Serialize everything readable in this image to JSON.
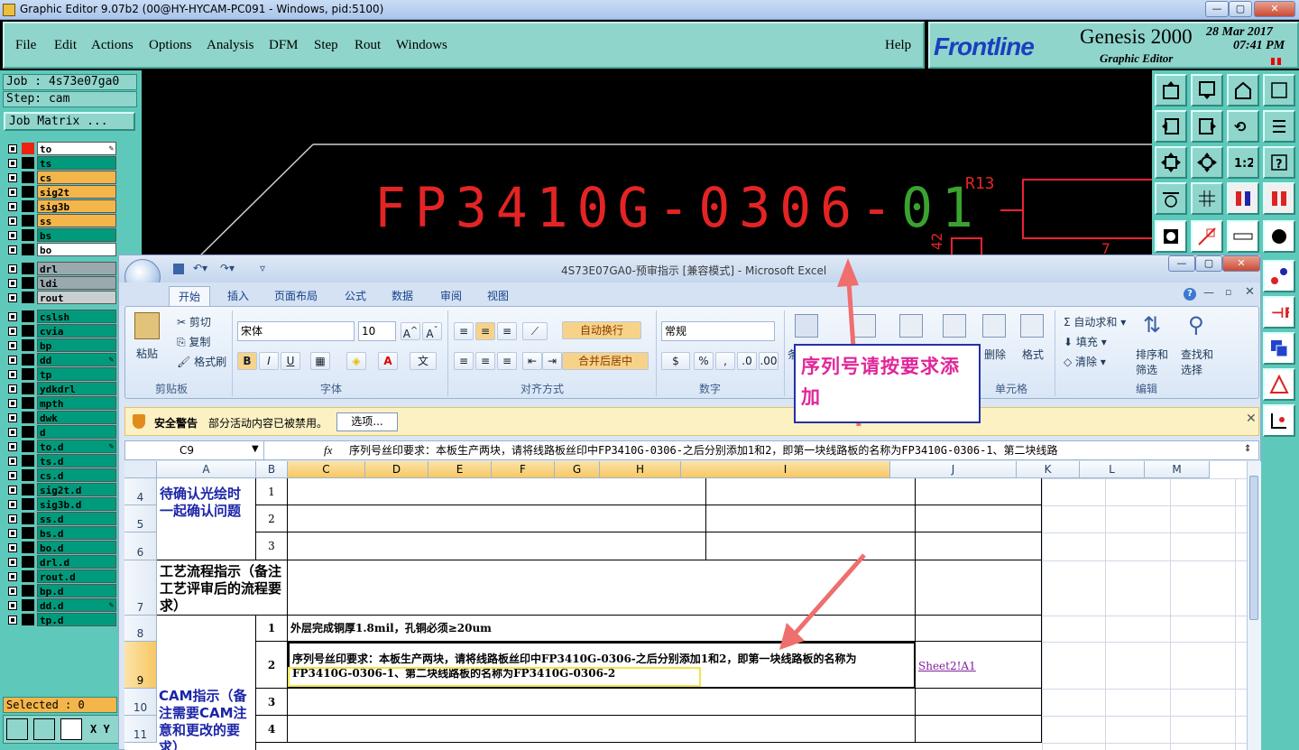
{
  "app": {
    "title": "Graphic Editor 9.07b2 (00@HY-HYCAM-PC091 - Windows, pid:5100)",
    "menu": [
      "File",
      "Edit",
      "Actions",
      "Options",
      "Analysis",
      "DFM",
      "Step",
      "Rout",
      "Windows"
    ],
    "help": "Help",
    "brand": {
      "logo": "Frontline",
      "product": "Genesis 2000",
      "subtitle": "Graphic Editor",
      "date": "28 Mar 2017",
      "time": "07:41 PM"
    }
  },
  "job_panel": {
    "job": "Job : 4s73e07ga0",
    "step": "Step: cam",
    "matrix_button": "Job Matrix ...",
    "selected": "Selected : 0",
    "xy": "X Y :",
    "layers_group1": [
      {
        "name": "to",
        "color": "#ffffff",
        "edit": true
      },
      {
        "name": "ts",
        "color": "#009b7c"
      },
      {
        "name": "cs",
        "color": "#f4b54a"
      },
      {
        "name": "sig2t",
        "color": "#f4b54a"
      },
      {
        "name": "sig3b",
        "color": "#f4b54a"
      },
      {
        "name": "ss",
        "color": "#f4b54a"
      },
      {
        "name": "bs",
        "color": "#009b7c"
      },
      {
        "name": "bo",
        "color": "#ffffff"
      }
    ],
    "layers_group2": [
      {
        "name": "drl",
        "color": "#9aa9ad"
      },
      {
        "name": "ldi",
        "color": "#9aa9ad"
      },
      {
        "name": "rout",
        "color": "#c9cfd1"
      }
    ],
    "layers_group3": [
      "cslsh",
      "cvia",
      "bp",
      "dd",
      "tp",
      "ydkdrl",
      "mpth",
      "dwk",
      "d",
      "to.d",
      "ts.d",
      "cs.d",
      "sig2t.d",
      "sig3b.d",
      "ss.d",
      "bs.d",
      "bo.d",
      "drl.d",
      "rout.d",
      "bp.d",
      "dd.d",
      "tp.d"
    ],
    "layers_group3_color": "#009b7c"
  },
  "canvas": {
    "main_text_red": "FP3410G-0306-",
    "main_text_green": "01",
    "ref_label": "R13",
    "ref_label2": "42",
    "ref_label3": "7"
  },
  "excel": {
    "title": "4S73E07GA0-预审指示 [兼容模式] - Microsoft Excel",
    "tabs": [
      "开始",
      "插入",
      "页面布局",
      "公式",
      "数据",
      "审阅",
      "视图"
    ],
    "active_tab": "开始",
    "ribbon": {
      "paste": "粘贴",
      "cut": "剪切",
      "copy": "复制",
      "format_painter": "格式刷",
      "clipboard": "剪贴板",
      "font_name": "宋体",
      "font_size": "10",
      "font_group": "字体",
      "wrap": "自动换行",
      "merge": "合并后居中",
      "align_group": "对齐方式",
      "number_format": "常规",
      "number_group": "数字",
      "cond": "条",
      "delete": "删除",
      "format": "格式",
      "cells_group": "单元格",
      "autosum": "自动求和",
      "fill": "填充",
      "clear": "清除",
      "sort": "排序和",
      "sort2": "筛选",
      "find": "查找和",
      "find2": "选择",
      "edit_group": "编辑"
    },
    "security": {
      "title": "安全警告",
      "text": "部分活动内容已被禁用。",
      "button": "选项..."
    },
    "name_box": "C9",
    "formula": "序列号丝印要求：本板生产两块，请将线路板丝印中FP3410G-0306-之后分别添加1和2，即第一块线路板的名称为FP3410G-0306-1、第二块线路",
    "columns": [
      "A",
      "B",
      "C",
      "D",
      "E",
      "F",
      "G",
      "H",
      "I",
      "J",
      "K",
      "L",
      "M"
    ],
    "rows": [
      "4",
      "5",
      "6",
      "7",
      "8",
      "9",
      "10",
      "11"
    ],
    "cells": {
      "a4": "待确认光绘时一起确认问题",
      "b4": "1",
      "b5": "2",
      "b6": "3",
      "a7": "工艺流程指示（备注工艺评审后的流程要求）",
      "b8": "1",
      "c8": "外层完成铜厚1.8mil，孔铜必须≥20um",
      "b9": "2",
      "c9": "序列号丝印要求：本板生产两块，请将线路板丝印中FP3410G-0306-之后分别添加1和2，即第一块线路板的名称为FP3410G-0306-1、第二块线路板的名称为FP3410G-0306-2",
      "j9": "Sheet2!A1",
      "a10": "CAM指示（备注需要CAM注意和更改的要求）",
      "b10": "3",
      "b11": "4"
    }
  },
  "annotation": {
    "text": "序列号请按要求添加",
    "color": "#e0279a",
    "arrow_color": "#ef6e6e"
  }
}
